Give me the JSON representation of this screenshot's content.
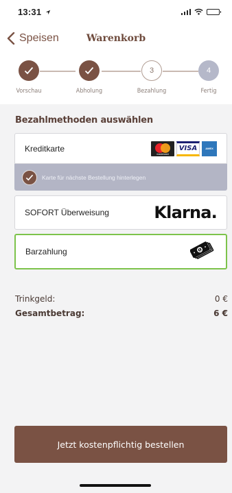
{
  "status_bar": {
    "time": "13:31",
    "location_icon": "location-arrow-icon",
    "icons": [
      "signal-icon",
      "wifi-icon",
      "battery-icon"
    ]
  },
  "nav": {
    "back_label": "Speisen",
    "title": "Warenkorb"
  },
  "steps": [
    {
      "label": "Vorschau",
      "state": "done",
      "marker": ""
    },
    {
      "label": "Abholung",
      "state": "done",
      "marker": ""
    },
    {
      "label": "Bezahlung",
      "state": "current",
      "marker": "3"
    },
    {
      "label": "Fertig",
      "state": "todo",
      "marker": "4"
    }
  ],
  "payment": {
    "section_title": "Bezahlmethoden auswählen",
    "kreditkarte": {
      "label": "Kreditkarte",
      "logos": [
        "mastercard",
        "visa",
        "american-express"
      ],
      "mastercard_text": "mastercard",
      "visa_text": "VISA",
      "amex_text": "AMEX"
    },
    "save_card": {
      "label": "Karte für nächste Bestellung hinterlegen",
      "checked": true
    },
    "sofort": {
      "label": "SOFORT Überweisung",
      "logo_text": "Klarna."
    },
    "bar": {
      "label": "Barzahlung",
      "selected": true,
      "icon": "cash-icon"
    }
  },
  "summary": {
    "tip_label": "Trinkgeld:",
    "tip_value": "0 €",
    "total_label": "Gesamtbetrag:",
    "total_value": "6 €"
  },
  "order_button": {
    "label": "Jetzt kostenpflichtig bestellen"
  },
  "colors": {
    "brand_brown": "#7a5244",
    "selected_border": "#7cc34a",
    "inactive_step": "#b5b8c9",
    "background": "#f3f3f4"
  }
}
